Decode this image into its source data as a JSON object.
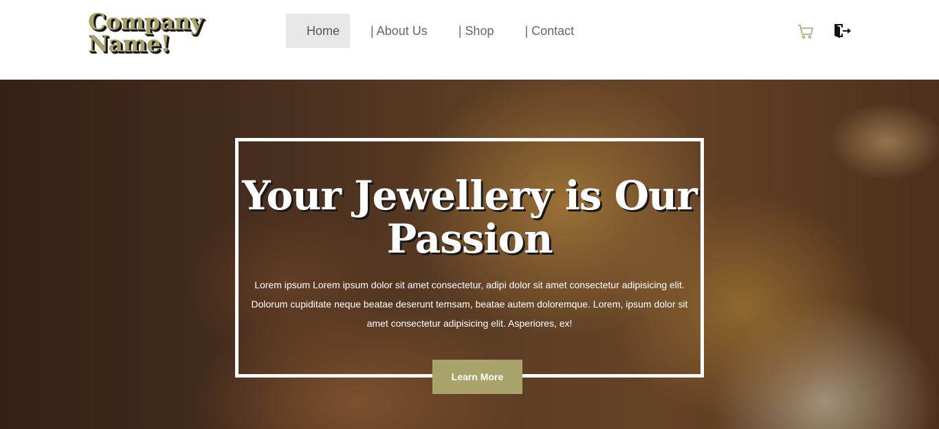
{
  "brand": {
    "name": "Company Name!"
  },
  "nav": {
    "items": [
      {
        "label": "Home",
        "active": true
      },
      {
        "label": "| About Us"
      },
      {
        "label": "| Shop"
      },
      {
        "label": "| Contact"
      }
    ]
  },
  "header_icons": {
    "cart": "cart-icon",
    "logout": "logout-icon"
  },
  "hero": {
    "title": "Your Jewellery is Our Passion",
    "text": "Lorem ipsum Lorem ipsum dolor sit amet consectetur, adipi dolor sit amet consectetur adipisicing elit. Dolorum cupiditate neque beatae deserunt temsam, beatae autem doloremque. Lorem, ipsum dolor sit amet consectetur adipisicing elit. Asperiores, ex!",
    "button_label": "Learn More"
  },
  "colors": {
    "accent": "#a8a36a",
    "nav_active_bg": "#e8e8e8",
    "nav_text": "#666666"
  }
}
